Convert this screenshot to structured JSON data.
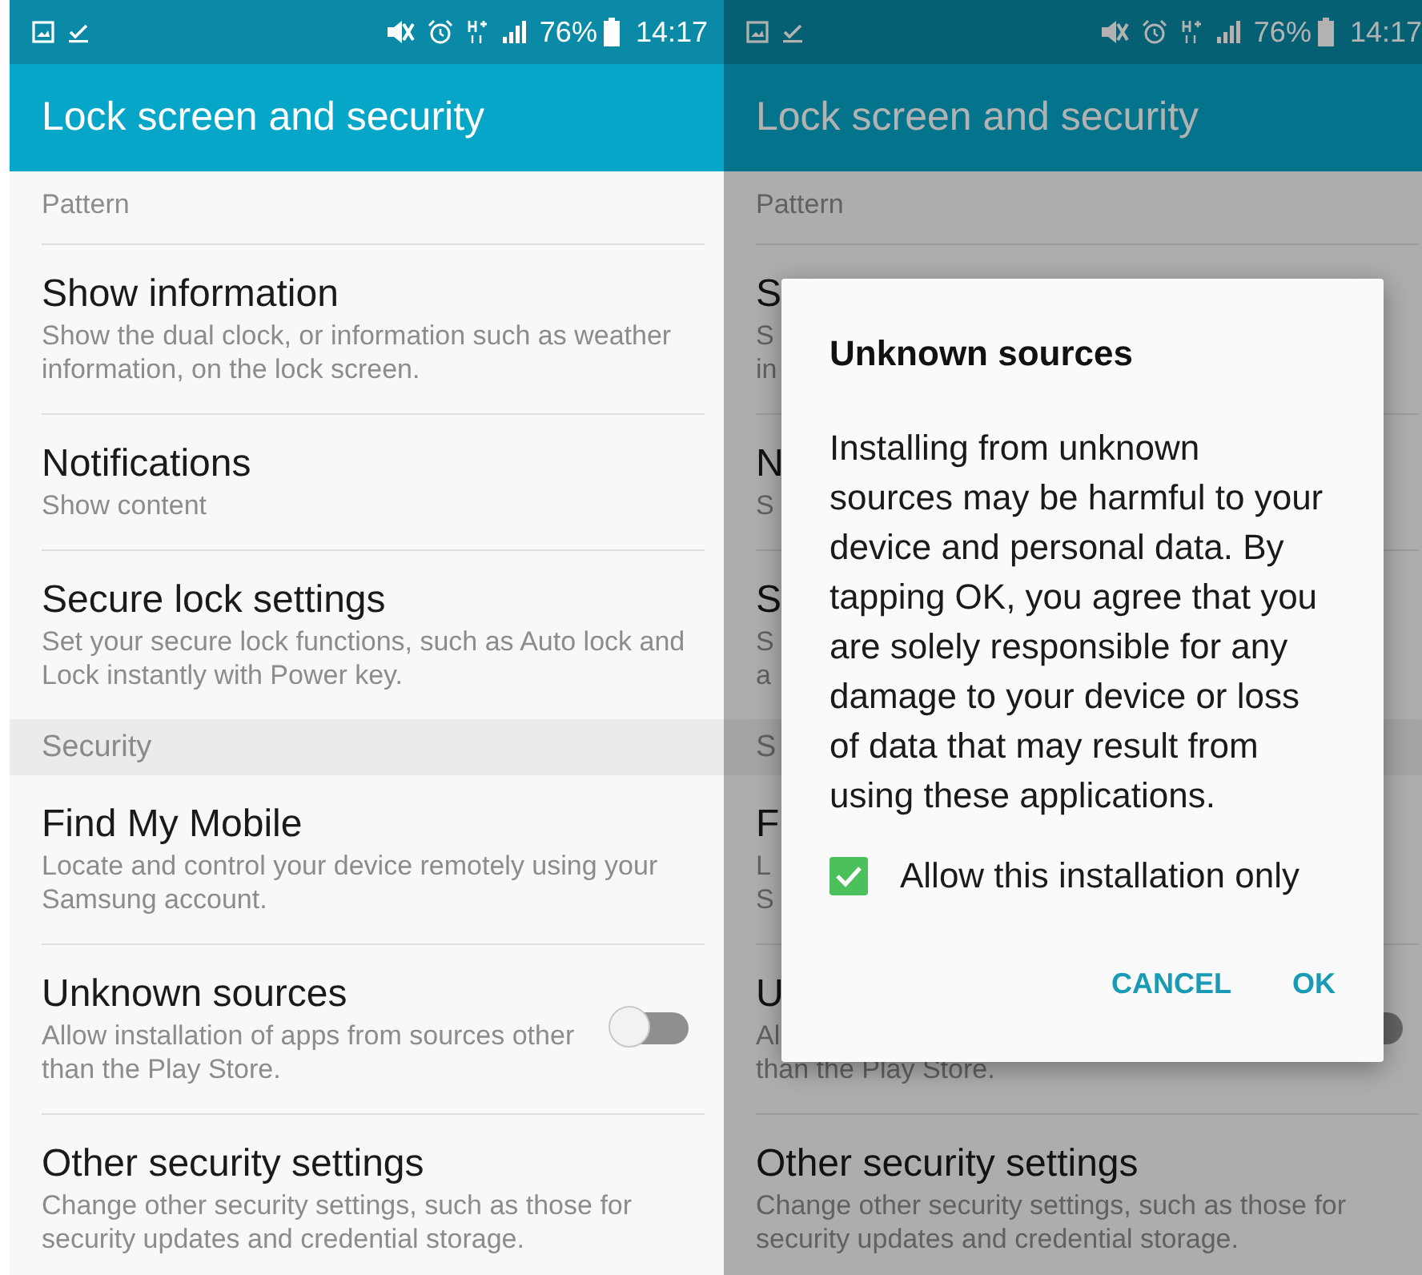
{
  "screens": [
    {
      "dimmed": false,
      "status_bar": {
        "battery": "76%",
        "time": "14:17"
      },
      "title": "Lock screen and security",
      "items": [
        {
          "kind": "sub",
          "description": "Pattern"
        },
        {
          "kind": "setting",
          "title": "Show information",
          "description": "Show the dual clock, or information such as weather information, on the lock screen."
        },
        {
          "kind": "setting",
          "title": "Notifications",
          "description": "Show content"
        },
        {
          "kind": "setting",
          "title": "Secure lock settings",
          "description": "Set your secure lock functions, such as Auto lock and Lock instantly with Power key."
        },
        {
          "kind": "header",
          "title": "Security"
        },
        {
          "kind": "setting",
          "title": "Find My Mobile",
          "description": "Locate and control your device remotely using your Samsung account."
        },
        {
          "kind": "switch",
          "title": "Unknown sources",
          "description": "Allow installation of apps from sources other than the Play Store.",
          "on": false
        },
        {
          "kind": "setting",
          "title": "Other security settings",
          "description": "Change other security settings, such as those for security updates and credential storage."
        }
      ]
    },
    {
      "dimmed": true,
      "status_bar": {
        "battery": "76%",
        "time": "14:17"
      },
      "title": "Lock screen and security",
      "items": [
        {
          "kind": "sub",
          "description": "Pattern"
        },
        {
          "kind": "setting",
          "title": "S",
          "description": "S\nin"
        },
        {
          "kind": "setting",
          "title": "N",
          "description": "S"
        },
        {
          "kind": "setting",
          "title": "S",
          "description": "S\na"
        },
        {
          "kind": "header",
          "title": "S"
        },
        {
          "kind": "setting",
          "title": "F",
          "description": "L\nS"
        },
        {
          "kind": "switch",
          "title": "U",
          "description": "Al\nthan the Play Store.",
          "on": false
        },
        {
          "kind": "setting",
          "title": "Other security settings",
          "description": "Change other security settings, such as those for security updates and credential storage."
        }
      ],
      "dialog": {
        "title": "Unknown sources",
        "message": "Installing from unknown sources may be harmful to your device and personal data. By tapping OK, you agree that you are solely responsible for any damage to your device or loss of data that may result from using these applications.",
        "checkbox": {
          "label": "Allow this installation only",
          "checked": true
        },
        "buttons": [
          "CANCEL",
          "OK"
        ]
      }
    }
  ]
}
